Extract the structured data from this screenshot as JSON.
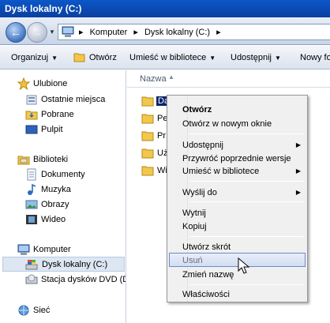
{
  "window": {
    "title": "Dysk lokalny (C:)"
  },
  "address": {
    "crumbs": [
      "Komputer",
      "Dysk lokalny (C:)"
    ]
  },
  "toolbar": {
    "organize": "Organizuj",
    "open": "Otwórz",
    "include_library": "Umieść w bibliotece",
    "share": "Udostępnij",
    "new_folder": "Nowy fo"
  },
  "nav": {
    "favorites": "Ulubione",
    "recent": "Ostatnie miejsca",
    "downloads": "Pobrane",
    "desktop": "Pulpit",
    "libraries": "Biblioteki",
    "documents": "Dokumenty",
    "music": "Muzyka",
    "pictures": "Obrazy",
    "video": "Wideo",
    "computer": "Komputer",
    "local_disk": "Dysk lokalny (C:)",
    "dvd_drive": "Stacja dysków DVD (D",
    "network": "Sieć"
  },
  "content": {
    "column_name": "Nazwa",
    "files": [
      {
        "name": "Dane",
        "selected": true
      },
      {
        "name": "Pe",
        "selected": false
      },
      {
        "name": "Pr",
        "selected": false
      },
      {
        "name": "Uż",
        "selected": false
      },
      {
        "name": "Wi",
        "selected": false
      }
    ]
  },
  "context_menu": {
    "items": [
      {
        "label": "Otwórz"
      },
      {
        "label": "Otwórz w nowym oknie"
      },
      {
        "label": "Udostępnij"
      },
      {
        "label": "Przywróć poprzednie wersje"
      },
      {
        "label": "Umieść w bibliotece"
      },
      {
        "label": "Wyślij do"
      },
      {
        "label": "Wytnij"
      },
      {
        "label": "Kopiuj"
      },
      {
        "label": "Utwórz skrót"
      },
      {
        "label": "Usuń"
      },
      {
        "label": "Zmień nazwę"
      },
      {
        "label": "Właściwości"
      }
    ],
    "submenu_glyph": "▶"
  },
  "colors": {
    "titlebar": "#0b57c9",
    "selection": "#0a246a",
    "menu_hover_border": "#6d8cc7",
    "folder": "#f2c84b"
  },
  "icons": {
    "back": "back-arrow-icon",
    "forward": "forward-arrow-icon",
    "folder": "folder-icon",
    "star": "star-icon",
    "drive": "drive-icon"
  }
}
